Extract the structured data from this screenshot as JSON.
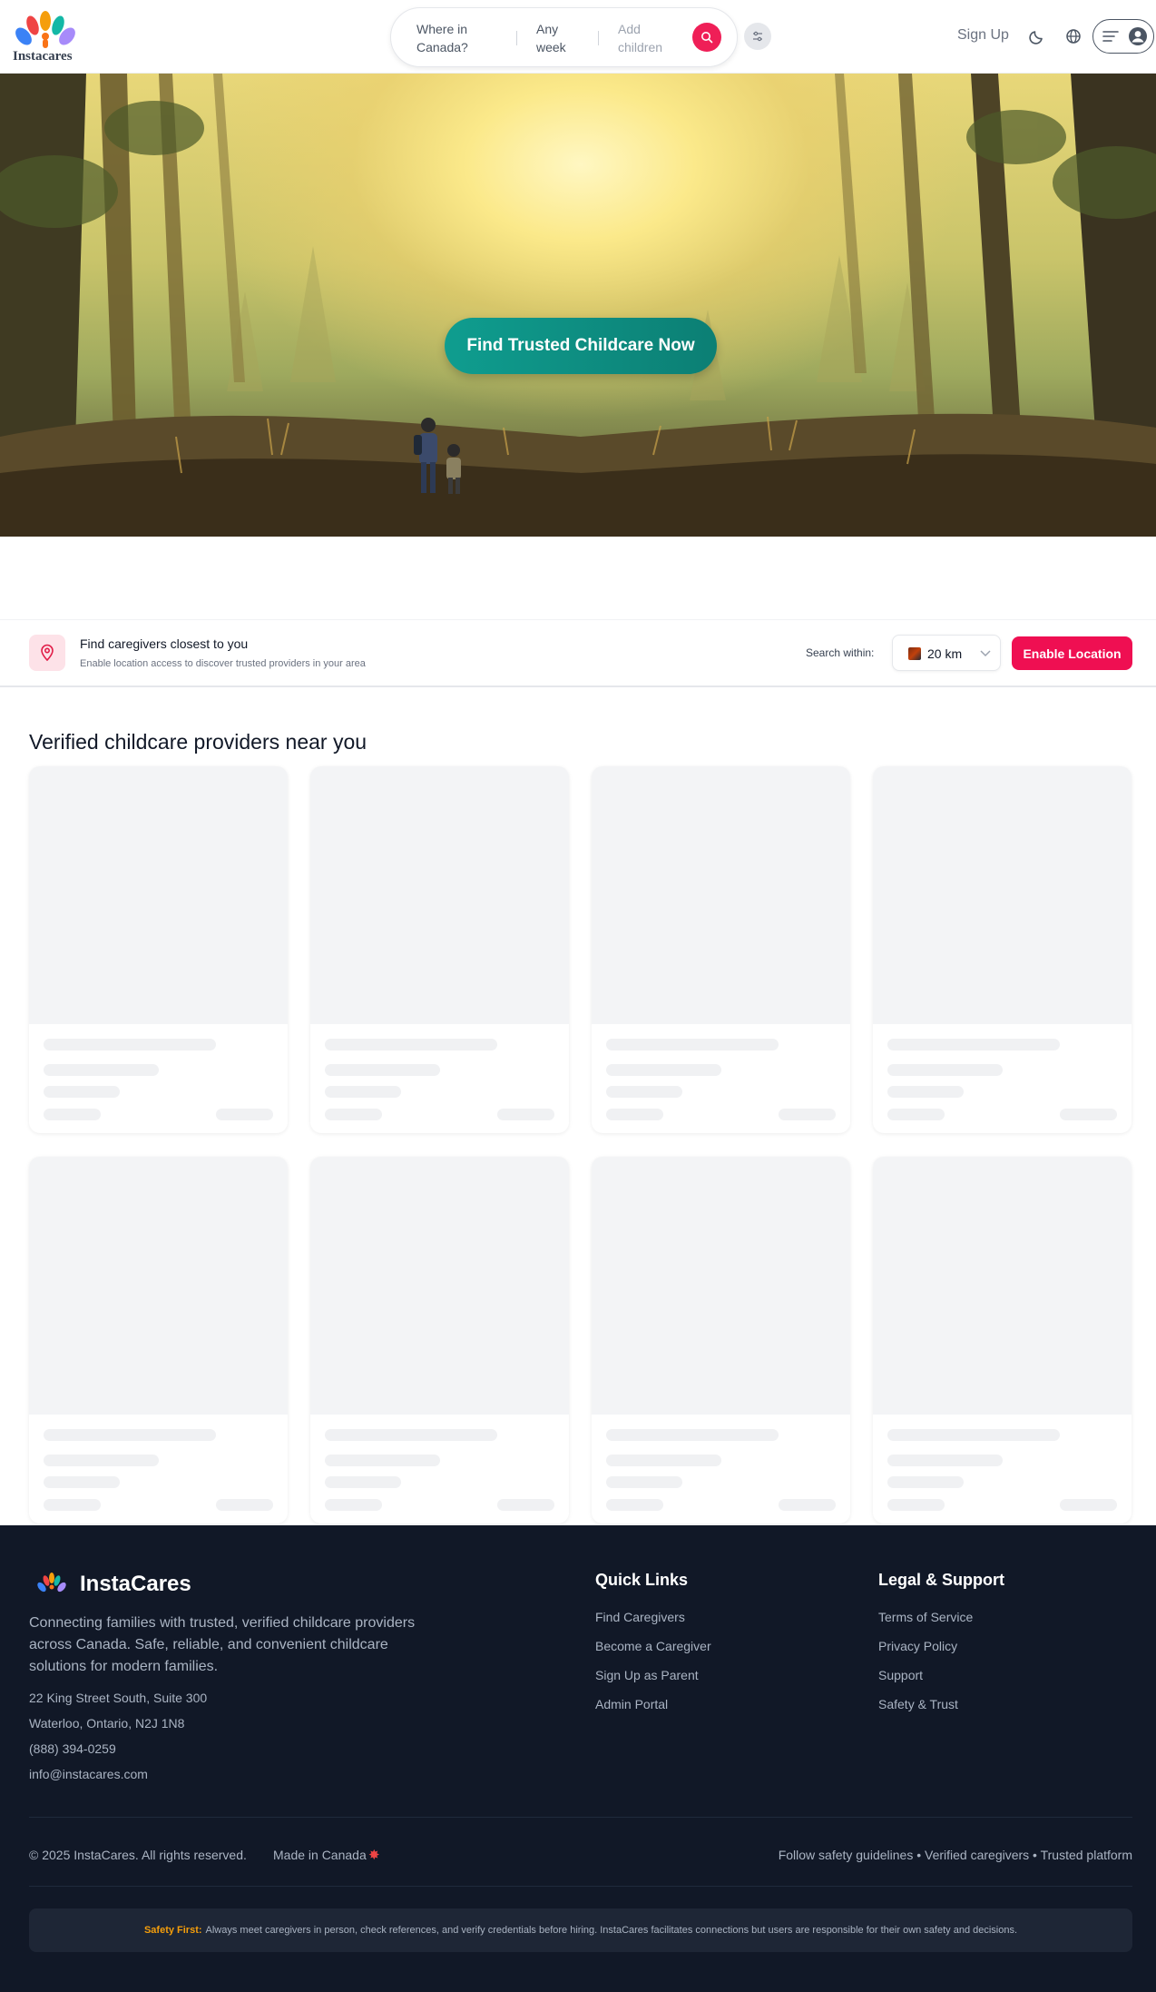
{
  "header": {
    "logo_text": "Instacares",
    "search": {
      "where": "Where in Canada?",
      "when": "Any week",
      "who": "Add children"
    },
    "signup_label": "Sign Up"
  },
  "hero": {
    "cta_label": "Find Trusted Childcare Now"
  },
  "location": {
    "title": "Find caregivers closest to you",
    "subtitle": "Enable location access to discover trusted providers in your area",
    "within_label": "Search within:",
    "radius": "20 km",
    "enable_label": "Enable Location"
  },
  "providers": {
    "title": "Verified childcare providers near you",
    "placeholder_cards": 8
  },
  "footer": {
    "brand": "InstaCares",
    "description": "Connecting families with trusted, verified childcare providers across Canada. Safe, reliable, and convenient childcare solutions for modern families.",
    "address": [
      "22 King Street South, Suite 300",
      "Waterloo, Ontario, N2J 1N8",
      "(888) 394-0259",
      "info@instacares.com"
    ],
    "quick_links": {
      "title": "Quick Links",
      "items": [
        "Find Caregivers",
        "Become a Caregiver",
        "Sign Up as Parent",
        "Admin Portal"
      ]
    },
    "legal": {
      "title": "Legal & Support",
      "items": [
        "Terms of Service",
        "Privacy Policy",
        "Support",
        "Safety & Trust"
      ]
    },
    "copyright": "© 2025 InstaCares. All rights reserved.",
    "made_in": "Made in Canada",
    "tagline": "Follow safety guidelines • Verified caregivers • Trusted platform",
    "notice_label": "Safety First:",
    "notice_text": "Always meet caregivers in person, check references, and verify credentials before hiring. InstaCares facilitates connections but users are responsible for their own safety and decisions."
  },
  "colors": {
    "brand_pink": "#ef0f52",
    "teal": "#0f9d8f",
    "footer_bg": "#111827"
  }
}
